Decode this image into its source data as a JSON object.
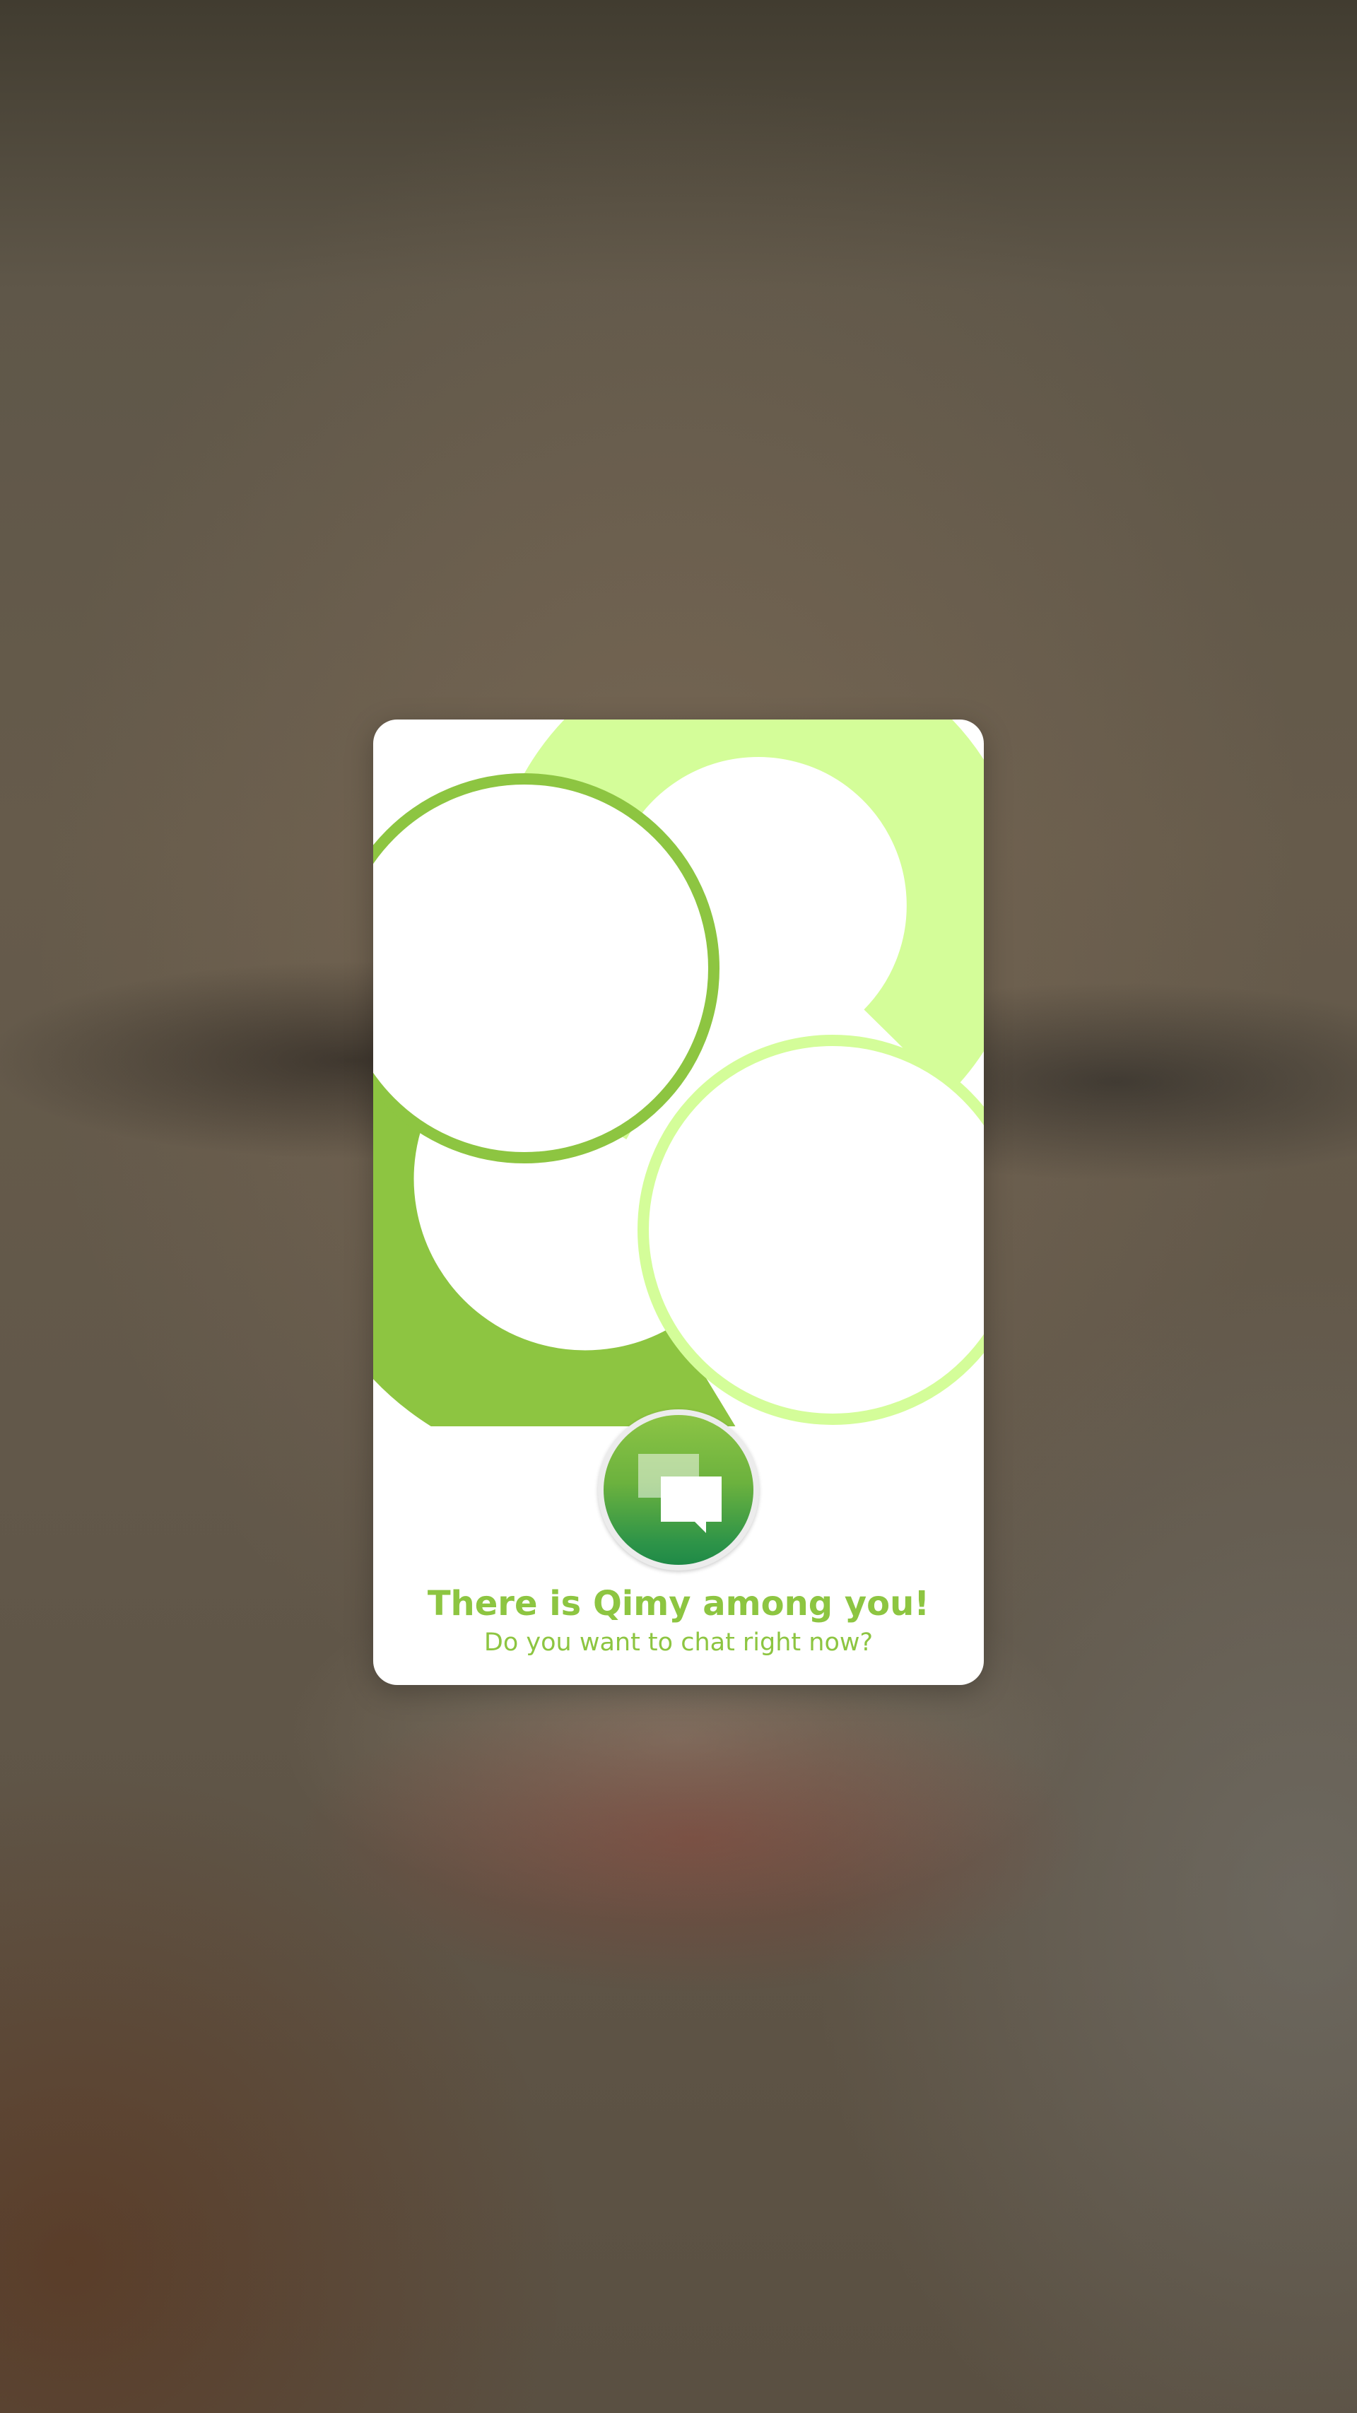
{
  "popup": {
    "title": "There is Qimy among you!",
    "subtitle": "Do you want to chat right now?",
    "close_icon": "close-icon",
    "chat_icon": "chat-bubbles-icon"
  },
  "colors": {
    "primary_green": "#8dc541",
    "light_green": "#d4fd99",
    "button_gradient_top": "#8cc445",
    "button_gradient_bottom": "#1f8a47"
  }
}
